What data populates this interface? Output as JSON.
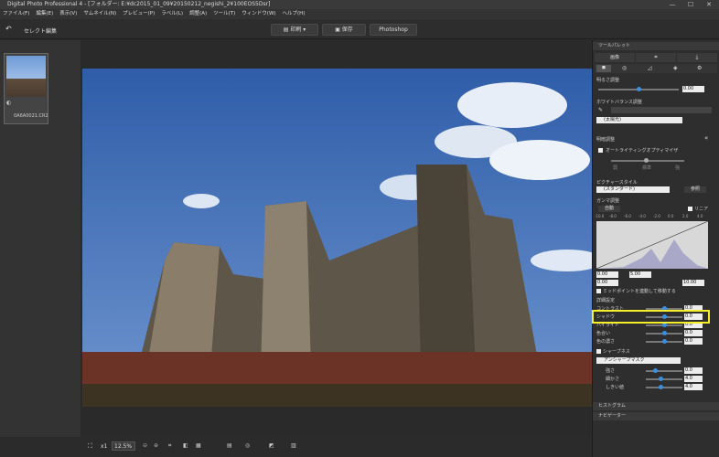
{
  "titlebar": {
    "title": "Digital Photo Professional 4 - [フォルダー: E:¥dc2015_01_09¥20150212_negishi_2¥100EOS5Dsr]",
    "min": "—",
    "max": "☐",
    "close": "✕"
  },
  "menu": [
    "ファイル(F)",
    "編集(E)",
    "表示(V)",
    "サムネイル(N)",
    "プレビュー(P)",
    "ラベル(L)",
    "調整(A)",
    "ツール(T)",
    "ウィンドウ(W)",
    "ヘルプ(H)"
  ],
  "toolbar": {
    "back": "セレクト編集",
    "print": "印刷",
    "save": "保存",
    "photoshop": "Photoshop"
  },
  "thumbnail": {
    "filename": "0A6A0021.CR2"
  },
  "status": {
    "fit": "x1",
    "zoom": "12.5%"
  },
  "tool_palette": {
    "title": "ツールパレット",
    "tabs": [
      "画像",
      "トリミング",
      "出力"
    ],
    "brightness": {
      "label": "明るさ調整",
      "value": "0.00"
    },
    "wb": {
      "label": "ホワイトバランス調整",
      "preset": "(太陽光)"
    },
    "dynamic": {
      "label": "明暗調整",
      "alo": "オートライティングオプティマイザ",
      "low": "弱",
      "std": "標準",
      "high": "強"
    },
    "picture_style": {
      "label": "ピクチャースタイル",
      "value": "(スタンダード)",
      "browse": "参照"
    },
    "tone": {
      "label": "ガンマ調整",
      "auto": "自動",
      "linear": "リニア",
      "scale": [
        "-10.0",
        "-8.0",
        "-6.0",
        "-4.0",
        "-2.0",
        "0.0",
        "2.0",
        "4.0"
      ],
      "in1": "0.00",
      "in2": "5.00",
      "out1": "0.00",
      "out2": "10.00",
      "note": "ミッドポイントを連動して移動する"
    },
    "detail": {
      "label": "詳細設定",
      "rows": [
        {
          "name": "コントラスト",
          "value": "0.0"
        },
        {
          "name": "シャドウ",
          "value": "0.0"
        },
        {
          "name": "ハイライト",
          "value": "0.0"
        },
        {
          "name": "色合い",
          "value": "0.0"
        },
        {
          "name": "色の濃さ",
          "value": "0.0"
        }
      ],
      "sharpness": "シャープネス",
      "usm": "アンシャープマスク",
      "usm_rows": [
        {
          "name": "強さ",
          "value": "0.0"
        },
        {
          "name": "細かさ",
          "value": "4.0"
        },
        {
          "name": "しきい値",
          "value": "4.0"
        }
      ]
    },
    "histogram": "ヒストグラム",
    "navigator": "ナビゲーター"
  },
  "colors": {
    "accent": "#3b8fe0",
    "highlight": "#f5ee2a"
  }
}
